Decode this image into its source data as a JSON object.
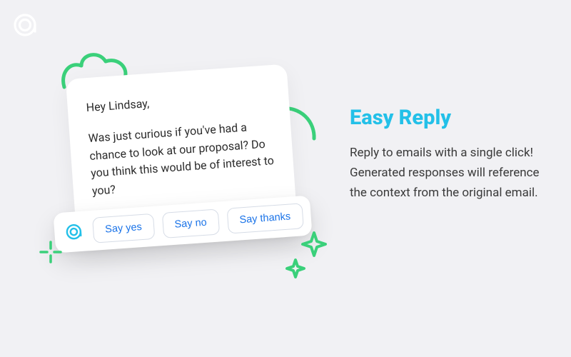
{
  "email": {
    "greeting": "Hey Lindsay,",
    "body": "Was just curious if you've had a chance to look at our proposal? Do you think this would be of interest to you?"
  },
  "reply_buttons": {
    "yes": "Say yes",
    "no": "Say no",
    "thanks": "Say thanks"
  },
  "promo": {
    "title": "Easy Reply",
    "description": "Reply to emails with a single click! Generated responses will reference the context from the original email."
  },
  "colors": {
    "accent": "#23c0e8",
    "button_text": "#1a73e8",
    "decor": "#3ad07a"
  }
}
